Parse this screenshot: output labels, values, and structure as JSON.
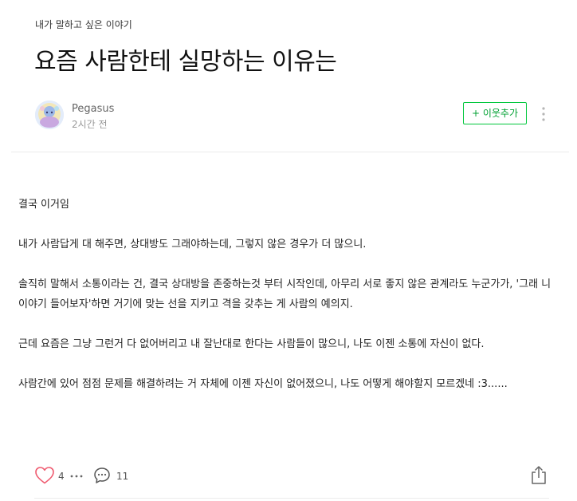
{
  "post": {
    "category": "내가 말하고 싶은 이야기",
    "title": "요즘 사람한테 실망하는 이유는",
    "author": {
      "name": "Pegasus",
      "time": "2시간 전"
    },
    "follow_label": "+ 이웃추가",
    "paragraphs": [
      "결국 이거임",
      "내가 사람답게 대 해주면, 상대방도 그래야하는데, 그렇지 않은 경우가 더 많으니.",
      "솔직히 말해서 소통이라는 건, 결국 상대방을 존중하는것 부터 시작인데, 아무리 서로 좋지 않은 관계라도 누군가가, '그래 니 이야기 들어보자'하면 거기에 맞는 선을 지키고 격을 갖추는 게 사람의 예의지.",
      "근데 요즘은 그냥 그런거 다 없어버리고 내 잘난대로 한다는 사람들이 많으니, 나도 이젠 소통에 자신이 없다.",
      "사람간에 있어 점점 문제를 해결하려는 거 자체에 이젠 자신이 없어졌으니, 나도 어떻게 해야할지 모르겠네 :3......"
    ]
  },
  "footer": {
    "like_count": "4",
    "comment_count": "11"
  },
  "icons": {
    "like": "heart-icon",
    "likers": "more-dots-icon",
    "comment": "speech-bubble-icon",
    "share": "share-icon",
    "menu": "vertical-dots-icon"
  },
  "colors": {
    "accent": "#00c73c",
    "heart": "#ef5a6f"
  }
}
